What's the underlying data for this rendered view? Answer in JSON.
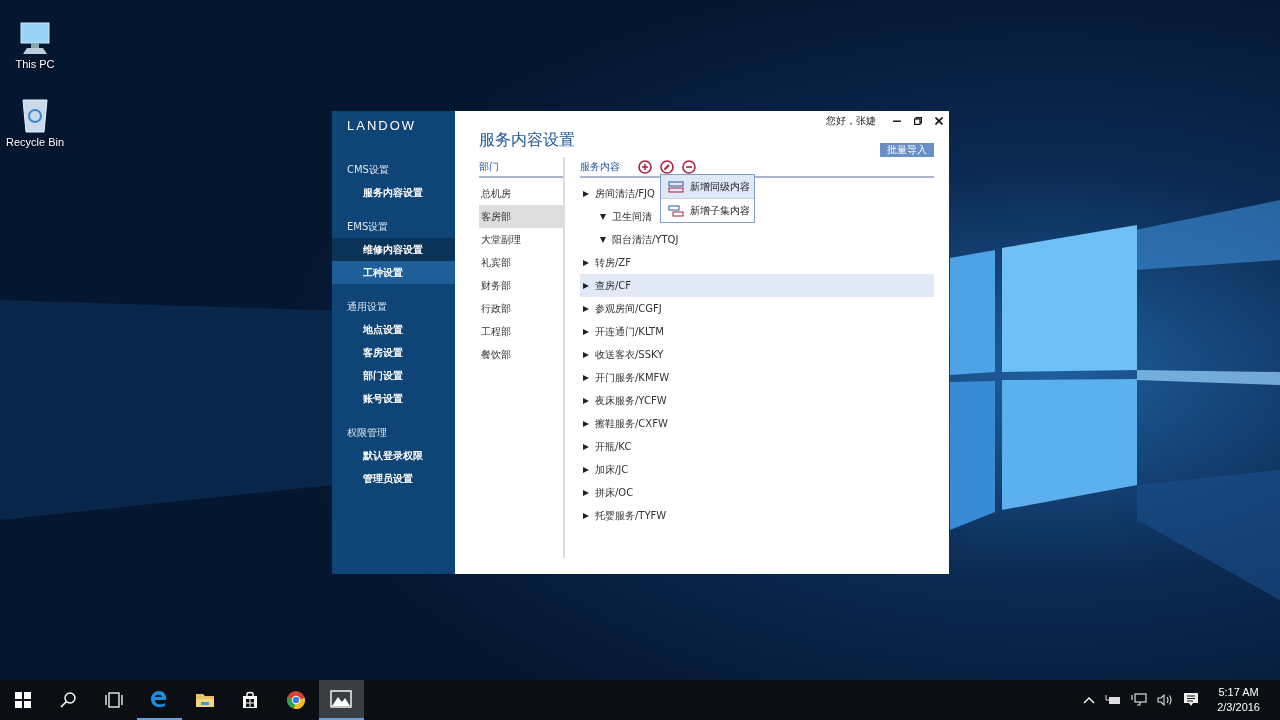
{
  "desktop_icons": [
    {
      "kind": "computer",
      "label": "This PC"
    },
    {
      "kind": "recycle-bin",
      "label": "Recycle Bin"
    }
  ],
  "window": {
    "logo": "LANDOW",
    "greeting": "您好，张婕",
    "sidebar": [
      {
        "title": "CMS设置",
        "items": [
          {
            "label": "服务内容设置",
            "selected": false,
            "hovered": false
          }
        ]
      },
      {
        "title": "EMS设置",
        "items": [
          {
            "label": "维修内容设置",
            "selected": false,
            "hovered": true
          },
          {
            "label": "工种设置",
            "selected": true,
            "hovered": false
          }
        ]
      },
      {
        "title": "通用设置",
        "items": [
          {
            "label": "地点设置",
            "selected": false,
            "hovered": false
          },
          {
            "label": "客房设置",
            "selected": false,
            "hovered": false
          },
          {
            "label": "部门设置",
            "selected": false,
            "hovered": false
          },
          {
            "label": "账号设置",
            "selected": false,
            "hovered": false
          }
        ]
      },
      {
        "title": "权限管理",
        "items": [
          {
            "label": "默认登录权限",
            "selected": false,
            "hovered": false
          },
          {
            "label": "管理员设置",
            "selected": false,
            "hovered": false
          }
        ]
      }
    ],
    "page_title": "服务内容设置",
    "import_button": "批量导入",
    "departments": {
      "header": "部门",
      "items": [
        {
          "label": "总机房",
          "selected": false
        },
        {
          "label": "客房部",
          "selected": true
        },
        {
          "label": "大堂副理",
          "selected": false
        },
        {
          "label": "礼宾部",
          "selected": false
        },
        {
          "label": "财务部",
          "selected": false
        },
        {
          "label": "行政部",
          "selected": false
        },
        {
          "label": "工程部",
          "selected": false
        },
        {
          "label": "餐饮部",
          "selected": false
        }
      ]
    },
    "services": {
      "header": "服务内容",
      "tree": [
        {
          "label": "房间清洁/FJQ",
          "expanded": false,
          "selected": false,
          "children": [
            {
              "label": "卫生间清",
              "expanded": true,
              "selected": false
            },
            {
              "label": "阳台清洁/YTQJ",
              "expanded": true,
              "selected": false
            }
          ]
        },
        {
          "label": "转房/ZF",
          "expanded": false,
          "selected": false
        },
        {
          "label": "查房/CF",
          "expanded": false,
          "selected": true
        },
        {
          "label": "参观房间/CGFJ",
          "expanded": false,
          "selected": false
        },
        {
          "label": "开连通门/KLTM",
          "expanded": false,
          "selected": false
        },
        {
          "label": "收送客衣/SSKY",
          "expanded": false,
          "selected": false
        },
        {
          "label": "开门服务/KMFW",
          "expanded": false,
          "selected": false
        },
        {
          "label": "夜床服务/YCFW",
          "expanded": false,
          "selected": false
        },
        {
          "label": "擦鞋服务/CXFW",
          "expanded": false,
          "selected": false
        },
        {
          "label": "开瓶/KC",
          "expanded": false,
          "selected": false
        },
        {
          "label": "加床/JC",
          "expanded": false,
          "selected": false
        },
        {
          "label": "拼床/OC",
          "expanded": false,
          "selected": false
        },
        {
          "label": "托婴服务/TYFW",
          "expanded": false,
          "selected": false
        }
      ]
    },
    "menu": [
      {
        "kind": "sibling",
        "label": "新增同级内容",
        "selected": true
      },
      {
        "kind": "child",
        "label": "新增子集内容",
        "selected": false
      }
    ]
  },
  "taskbar": {
    "buttons": [
      {
        "kind": "start",
        "open": false,
        "active": false
      },
      {
        "kind": "search",
        "open": false,
        "active": false
      },
      {
        "kind": "task-view",
        "open": false,
        "active": false
      },
      {
        "kind": "edge",
        "open": true,
        "active": false
      },
      {
        "kind": "folder",
        "open": false,
        "active": false
      },
      {
        "kind": "store",
        "open": false,
        "active": false
      },
      {
        "kind": "chrome",
        "open": false,
        "active": false
      },
      {
        "kind": "photos",
        "open": true,
        "active": true
      }
    ],
    "time": "5:17 AM",
    "date": "2/3/2016"
  }
}
